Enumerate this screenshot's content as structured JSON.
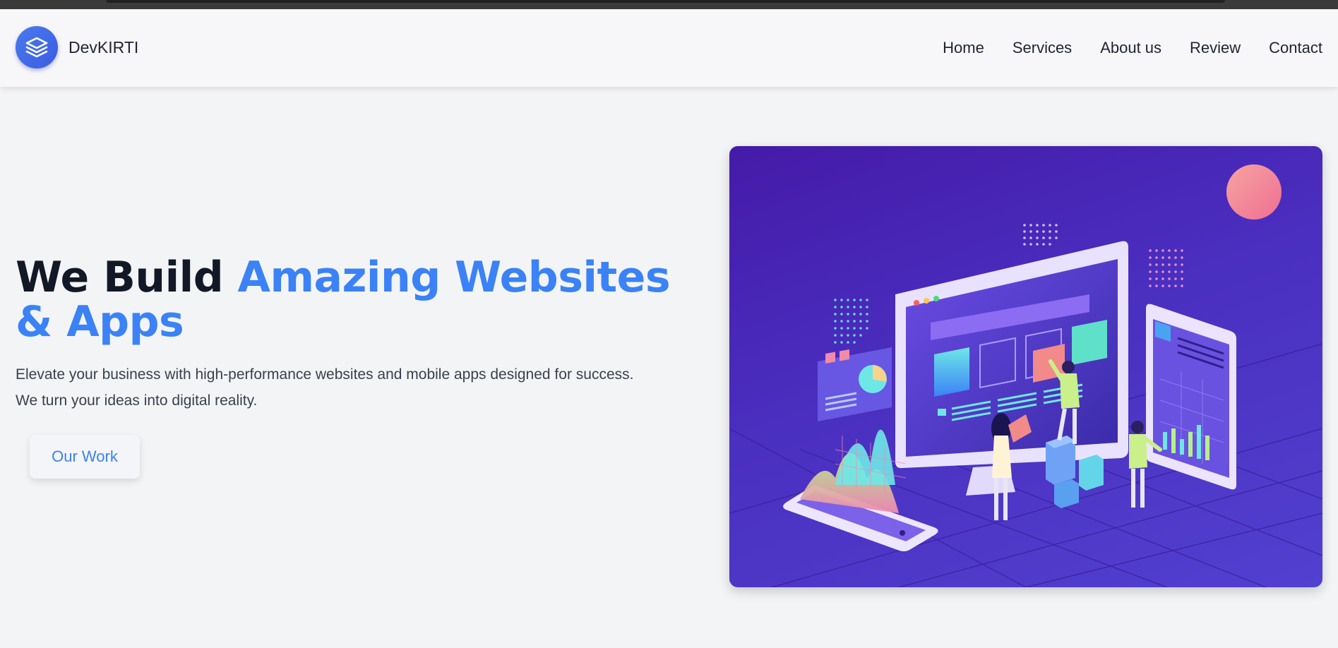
{
  "brand": {
    "name": "DevKIRTI",
    "logo_icon": "layers-icon"
  },
  "nav": {
    "items": [
      {
        "label": "Home"
      },
      {
        "label": "Services"
      },
      {
        "label": "About us"
      },
      {
        "label": "Review"
      },
      {
        "label": "Contact"
      }
    ]
  },
  "hero": {
    "title_part1": "We Build ",
    "title_part2": "Amazing Websites & Apps",
    "description_line1": "Elevate your business with high-performance websites and mobile apps designed for success.",
    "description_line2": "We turn your ideas into digital reality.",
    "cta_label": "Our Work",
    "illustration": "isometric-web-development-illustration"
  },
  "colors": {
    "accent": "#3b82f6",
    "title_dark": "#121826",
    "logo": "#3b5be0",
    "illustration_bg": "#4a2fc0"
  }
}
